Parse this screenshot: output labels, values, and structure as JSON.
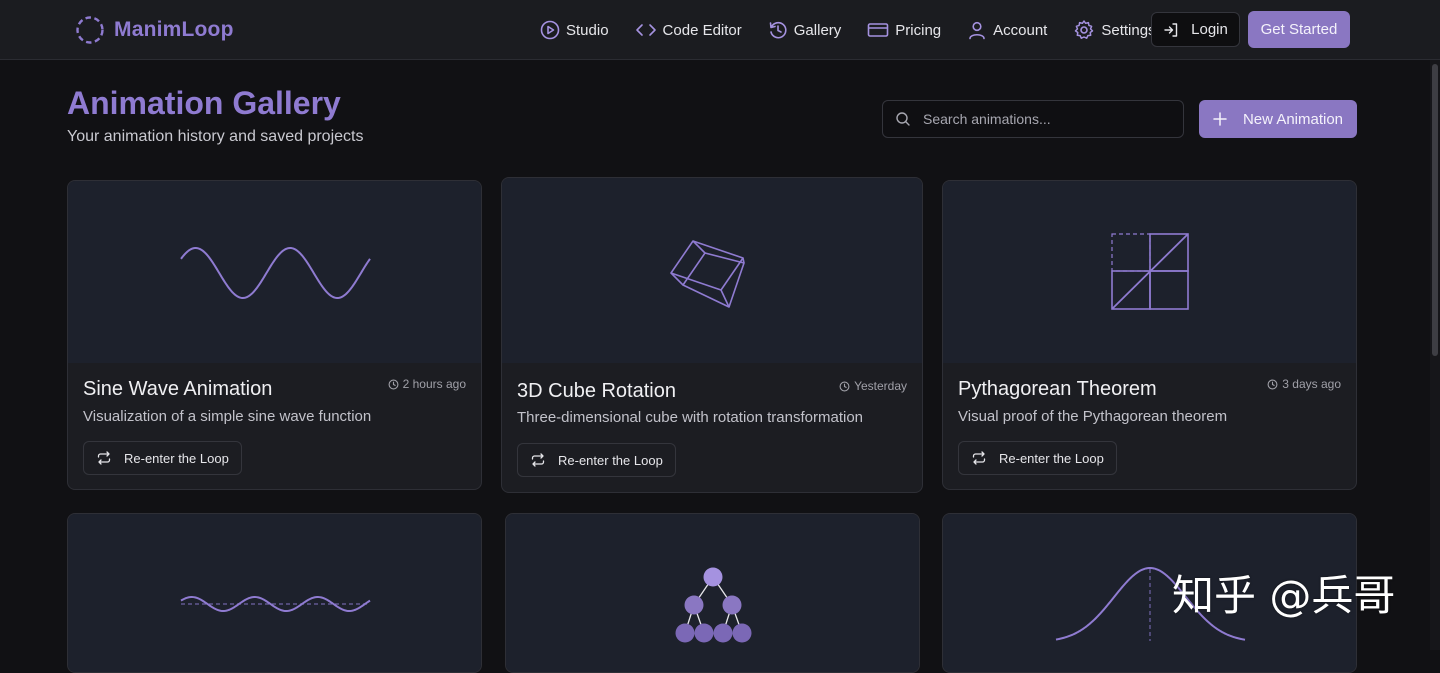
{
  "brand": {
    "name": "ManimLoop",
    "accent": "#8f7bd1"
  },
  "nav": {
    "items": [
      {
        "label": "Studio",
        "icon": "play-circle-icon"
      },
      {
        "label": "Code Editor",
        "icon": "code-icon"
      },
      {
        "label": "Gallery",
        "icon": "history-icon"
      },
      {
        "label": "Pricing",
        "icon": "credit-card-icon"
      },
      {
        "label": "Account",
        "icon": "user-icon"
      },
      {
        "label": "Settings",
        "icon": "gear-icon"
      }
    ],
    "login_label": "Login",
    "get_started_label": "Get Started"
  },
  "header": {
    "title": "Animation Gallery",
    "subtitle": "Your animation history and saved projects",
    "search_placeholder": "Search animations...",
    "new_button_label": "New Animation"
  },
  "cards": [
    {
      "title": "Sine Wave Animation",
      "description": "Visualization of a simple sine wave function",
      "time": "2 hours ago",
      "action": "Re-enter the Loop",
      "preview": "sine-wave"
    },
    {
      "title": "3D Cube Rotation",
      "description": "Three-dimensional cube with rotation transformation",
      "time": "Yesterday",
      "action": "Re-enter the Loop",
      "preview": "cube"
    },
    {
      "title": "Pythagorean Theorem",
      "description": "Visual proof of the Pythagorean theorem",
      "time": "3 days ago",
      "action": "Re-enter the Loop",
      "preview": "pythagorean"
    },
    {
      "preview": "damped-wave"
    },
    {
      "preview": "binary-tree"
    },
    {
      "preview": "normal-distribution"
    }
  ],
  "watermark": "知乎 @兵哥"
}
